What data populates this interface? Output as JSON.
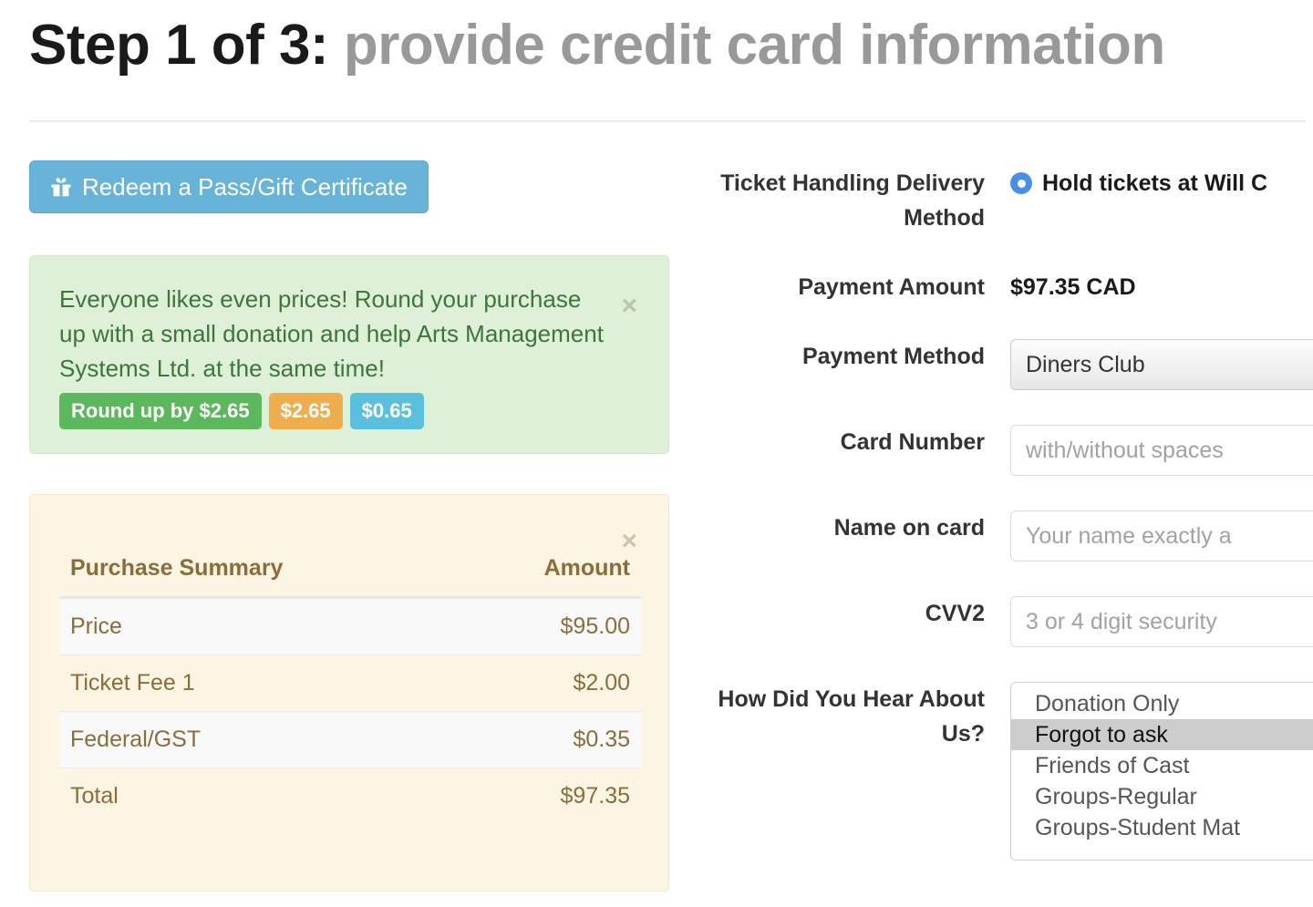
{
  "header": {
    "step_label": "Step 1 of 3:",
    "title_rest": " provide credit card information"
  },
  "left": {
    "redeem_button": "Redeem a Pass/Gift Certificate",
    "redeem_icon": "gift-icon",
    "donation_alert": {
      "message": "Everyone likes even prices!   Round your purchase up with a small donation and help Arts Management Systems Ltd. at the same time!",
      "close_label": "×",
      "buttons": [
        {
          "label": "Round up by $2.65",
          "color": "#5cb85c"
        },
        {
          "label": "$2.65",
          "color": "#f0ad4e"
        },
        {
          "label": "$0.65",
          "color": "#5bc0de"
        }
      ]
    },
    "summary": {
      "close_label": "×",
      "columns": [
        "Purchase Summary",
        "Amount"
      ],
      "rows": [
        {
          "label": "Price",
          "amount": "$95.00"
        },
        {
          "label": "Ticket Fee 1",
          "amount": "$2.00"
        },
        {
          "label": "Federal/GST",
          "amount": "$0.35"
        },
        {
          "label": "Total",
          "amount": "$97.35"
        }
      ]
    }
  },
  "form": {
    "delivery": {
      "label": "Ticket Handling Delivery Method",
      "option_label": "Hold tickets at Will C",
      "selected": true
    },
    "payment_amount": {
      "label": "Payment Amount",
      "value": "$97.35 CAD"
    },
    "payment_method": {
      "label": "Payment Method",
      "value": "Diners Club"
    },
    "card_number": {
      "label": "Card Number",
      "placeholder": "with/without spaces"
    },
    "name_on_card": {
      "label": "Name on card",
      "placeholder": "Your name exactly a"
    },
    "cvv2": {
      "label": "CVV2",
      "placeholder": "3 or 4 digit security "
    },
    "hear_about_us": {
      "label": "How Did You Hear About Us?",
      "options": [
        "Donation Only",
        "Forgot to ask",
        "Friends of Cast",
        "Groups-Regular",
        "Groups-Student Mat"
      ],
      "selected_index": 1
    }
  },
  "colors": {
    "accent_blue": "#68b3d8",
    "alert_green_bg": "#dff0d8",
    "alert_green_text": "#3c763d",
    "summary_bg": "#fcf5e3",
    "summary_text": "#8a6d3b",
    "radio_blue": "#4a90e2"
  }
}
